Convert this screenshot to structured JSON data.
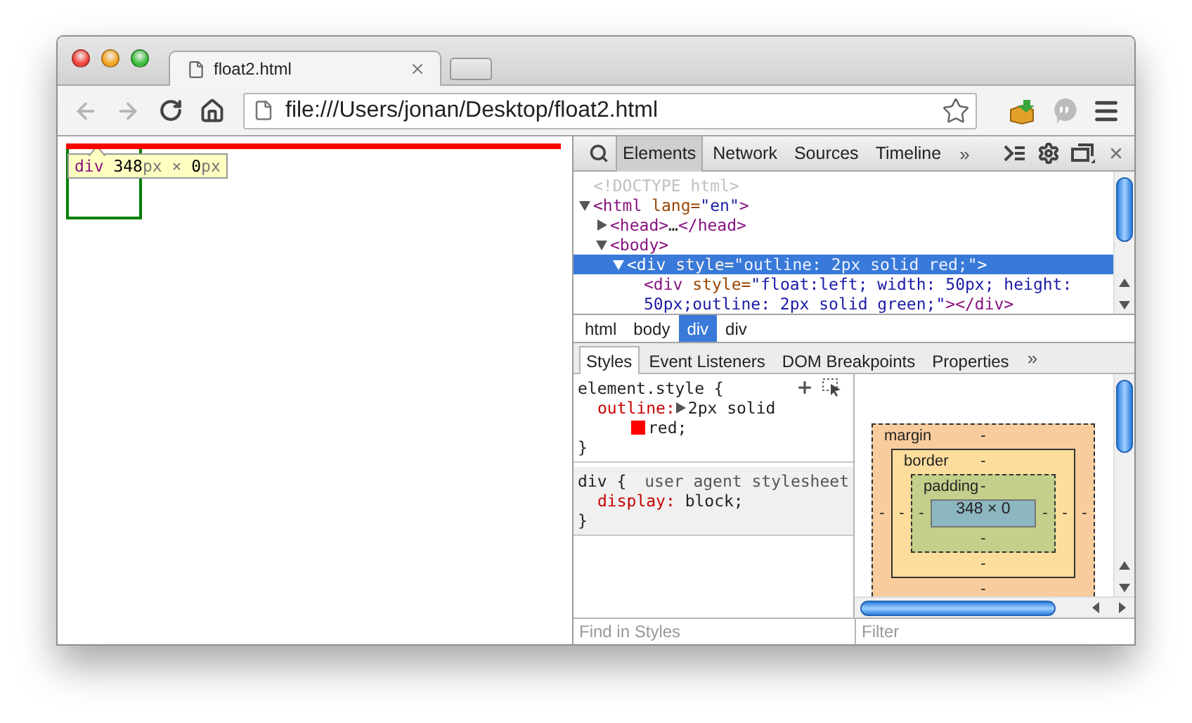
{
  "window": {
    "tab": {
      "title": "float2.html"
    }
  },
  "toolbar": {
    "back": {
      "disabled": true
    },
    "forward": {
      "disabled": true
    },
    "address": {
      "value": "file:///Users/jonan/Desktop/float2.html"
    }
  },
  "viewport": {
    "tooltip": [
      {
        "kind": "tag",
        "text": "div "
      },
      {
        "kind": "num",
        "text": "348"
      },
      {
        "kind": "unit",
        "text": "px × "
      },
      {
        "kind": "num",
        "text": "0"
      },
      {
        "kind": "unit",
        "text": "px"
      }
    ]
  },
  "devtools": {
    "panel_tabs": [
      {
        "label": "Elements",
        "selected": true
      },
      {
        "label": "Network",
        "selected": false
      },
      {
        "label": "Sources",
        "selected": false
      },
      {
        "label": "Timeline",
        "selected": false
      }
    ],
    "panel_more": "»",
    "dom_tree": [
      {
        "tokens": [
          {
            "kind": "doctype",
            "text": "<!DOCTYPE html>"
          }
        ],
        "selected": false
      },
      {
        "tokens": [
          {
            "kind": "tag",
            "text": "<html"
          },
          {
            "kind": "attr",
            "text": " lang="
          },
          {
            "kind": "value",
            "text": "\"en\""
          },
          {
            "kind": "tag",
            "text": ">"
          }
        ],
        "expanded": true,
        "selected": false,
        "children": [
          {
            "tokens": [
              {
                "kind": "tag",
                "text": "<head>"
              },
              {
                "kind": "text",
                "text": "…"
              },
              {
                "kind": "tag",
                "text": "</head>"
              }
            ],
            "expanded": false,
            "selected": false
          },
          {
            "tokens": [
              {
                "kind": "tag",
                "text": "<body>"
              }
            ],
            "expanded": true,
            "selected": false,
            "children": [
              {
                "tokens": [
                  {
                    "kind": "tag",
                    "text": "<div"
                  },
                  {
                    "kind": "attr",
                    "text": " style="
                  },
                  {
                    "kind": "value",
                    "text": "\"outline: 2px solid red;\""
                  },
                  {
                    "kind": "tag",
                    "text": ">"
                  }
                ],
                "expanded": true,
                "selected": true,
                "children": [
                  {
                    "tokens": [
                      {
                        "kind": "tag",
                        "text": "<div"
                      },
                      {
                        "kind": "attr",
                        "text": " style="
                      },
                      {
                        "kind": "value",
                        "text": "\"float:left; width: 50px; height: 50px;outline: 2px solid green;\""
                      },
                      {
                        "kind": "tag",
                        "text": "></div>"
                      }
                    ],
                    "selected": false
                  }
                ]
              }
            ]
          }
        ]
      }
    ],
    "breadcrumbs": [
      {
        "label": "html",
        "selected": false
      },
      {
        "label": "body",
        "selected": false
      },
      {
        "label": "div",
        "selected": true
      },
      {
        "label": "div",
        "selected": false
      }
    ],
    "sidebar_tabs": [
      {
        "label": "Styles",
        "selected": true
      },
      {
        "label": "Event Listeners",
        "selected": false
      },
      {
        "label": "DOM Breakpoints",
        "selected": false
      },
      {
        "label": "Properties",
        "selected": false
      }
    ],
    "sidebar_more": "»",
    "styles": [
      {
        "selector": "element.style {",
        "properties": [
          {
            "name": "outline:",
            "expander": true,
            "value": "2px solid",
            "color": "#ff0000",
            "color_value": "red;"
          }
        ],
        "close": "}"
      },
      {
        "selector": "div {",
        "source": "user agent stylesheet",
        "properties": [
          {
            "name": "display:",
            "value": " block;"
          }
        ],
        "close": "}"
      }
    ],
    "box_model": {
      "margin": {
        "label": "margin",
        "top": "-",
        "right": "-",
        "bottom": "-",
        "left": "-"
      },
      "border": {
        "label": "border",
        "top": "-",
        "right": "-",
        "bottom": "-",
        "left": "-"
      },
      "padding": {
        "label": "padding",
        "top": "-",
        "right": "-",
        "bottom": "-",
        "left": "-"
      },
      "content": "348 × 0"
    },
    "find_placeholder": "Find in Styles",
    "filter_placeholder": "Filter"
  }
}
